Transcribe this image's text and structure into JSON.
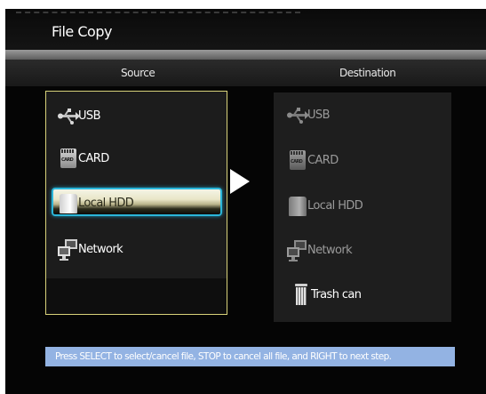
{
  "window": {
    "title": "File Copy"
  },
  "columns": {
    "source": "Source",
    "destination": "Destination"
  },
  "source_items": [
    {
      "label": "USB",
      "icon": "usb-icon"
    },
    {
      "label": "CARD",
      "icon": "card-icon"
    },
    {
      "label": "Local HDD",
      "icon": "hdd-icon",
      "selected": true
    },
    {
      "label": "Network",
      "icon": "network-icon"
    }
  ],
  "destination_items": [
    {
      "label": "USB",
      "icon": "usb-icon"
    },
    {
      "label": "CARD",
      "icon": "card-icon"
    },
    {
      "label": "Local HDD",
      "icon": "hdd-icon"
    },
    {
      "label": "Network",
      "icon": "network-icon"
    },
    {
      "label": "Trash can",
      "icon": "trash-icon"
    }
  ],
  "help": {
    "text": "Press SELECT to select/cancel file, STOP to cancel all file, and RIGHT to next step."
  },
  "colors": {
    "background": "#050505",
    "panel_border": "#d8d27a",
    "selection_border": "#2bb6d9",
    "help_bar": "#93b3e3"
  }
}
